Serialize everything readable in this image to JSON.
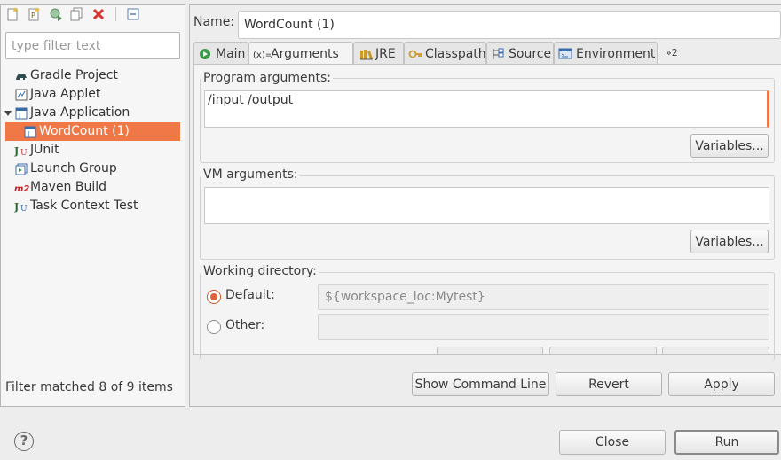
{
  "sidebar": {
    "filter_placeholder": "type filter text",
    "items": [
      {
        "label": "Gradle Project"
      },
      {
        "label": "Java Applet"
      },
      {
        "label": "Java Application"
      },
      {
        "label": "WordCount (1)"
      },
      {
        "label": "JUnit"
      },
      {
        "label": "Launch Group"
      },
      {
        "label": "Maven Build"
      },
      {
        "label": "Task Context Test"
      }
    ],
    "filter_status": "Filter matched 8 of 9 items"
  },
  "header": {
    "name_label": "Name:",
    "name_value": "WordCount (1)"
  },
  "tabs": [
    {
      "label": "Main"
    },
    {
      "label": "Arguments"
    },
    {
      "label": "JRE"
    },
    {
      "label": "Classpath"
    },
    {
      "label": "Source"
    },
    {
      "label": "Environment"
    },
    {
      "label": "»2"
    }
  ],
  "arguments": {
    "program_title": "Program arguments:",
    "program_value": "/input /output",
    "vm_title": "VM arguments:",
    "vm_value": "",
    "variables_label": "Variables...",
    "working_dir_title": "Working directory:",
    "default_label": "Default:",
    "default_value": "${workspace_loc:Mytest}",
    "other_label": "Other:",
    "other_value": ""
  },
  "actions": {
    "show_command_line": "Show Command Line",
    "revert": "Revert",
    "apply": "Apply",
    "close": "Close",
    "run": "Run"
  },
  "footer": {
    "help": "?"
  },
  "colors": {
    "selection": "#f07746",
    "radio": "#e0643a"
  }
}
